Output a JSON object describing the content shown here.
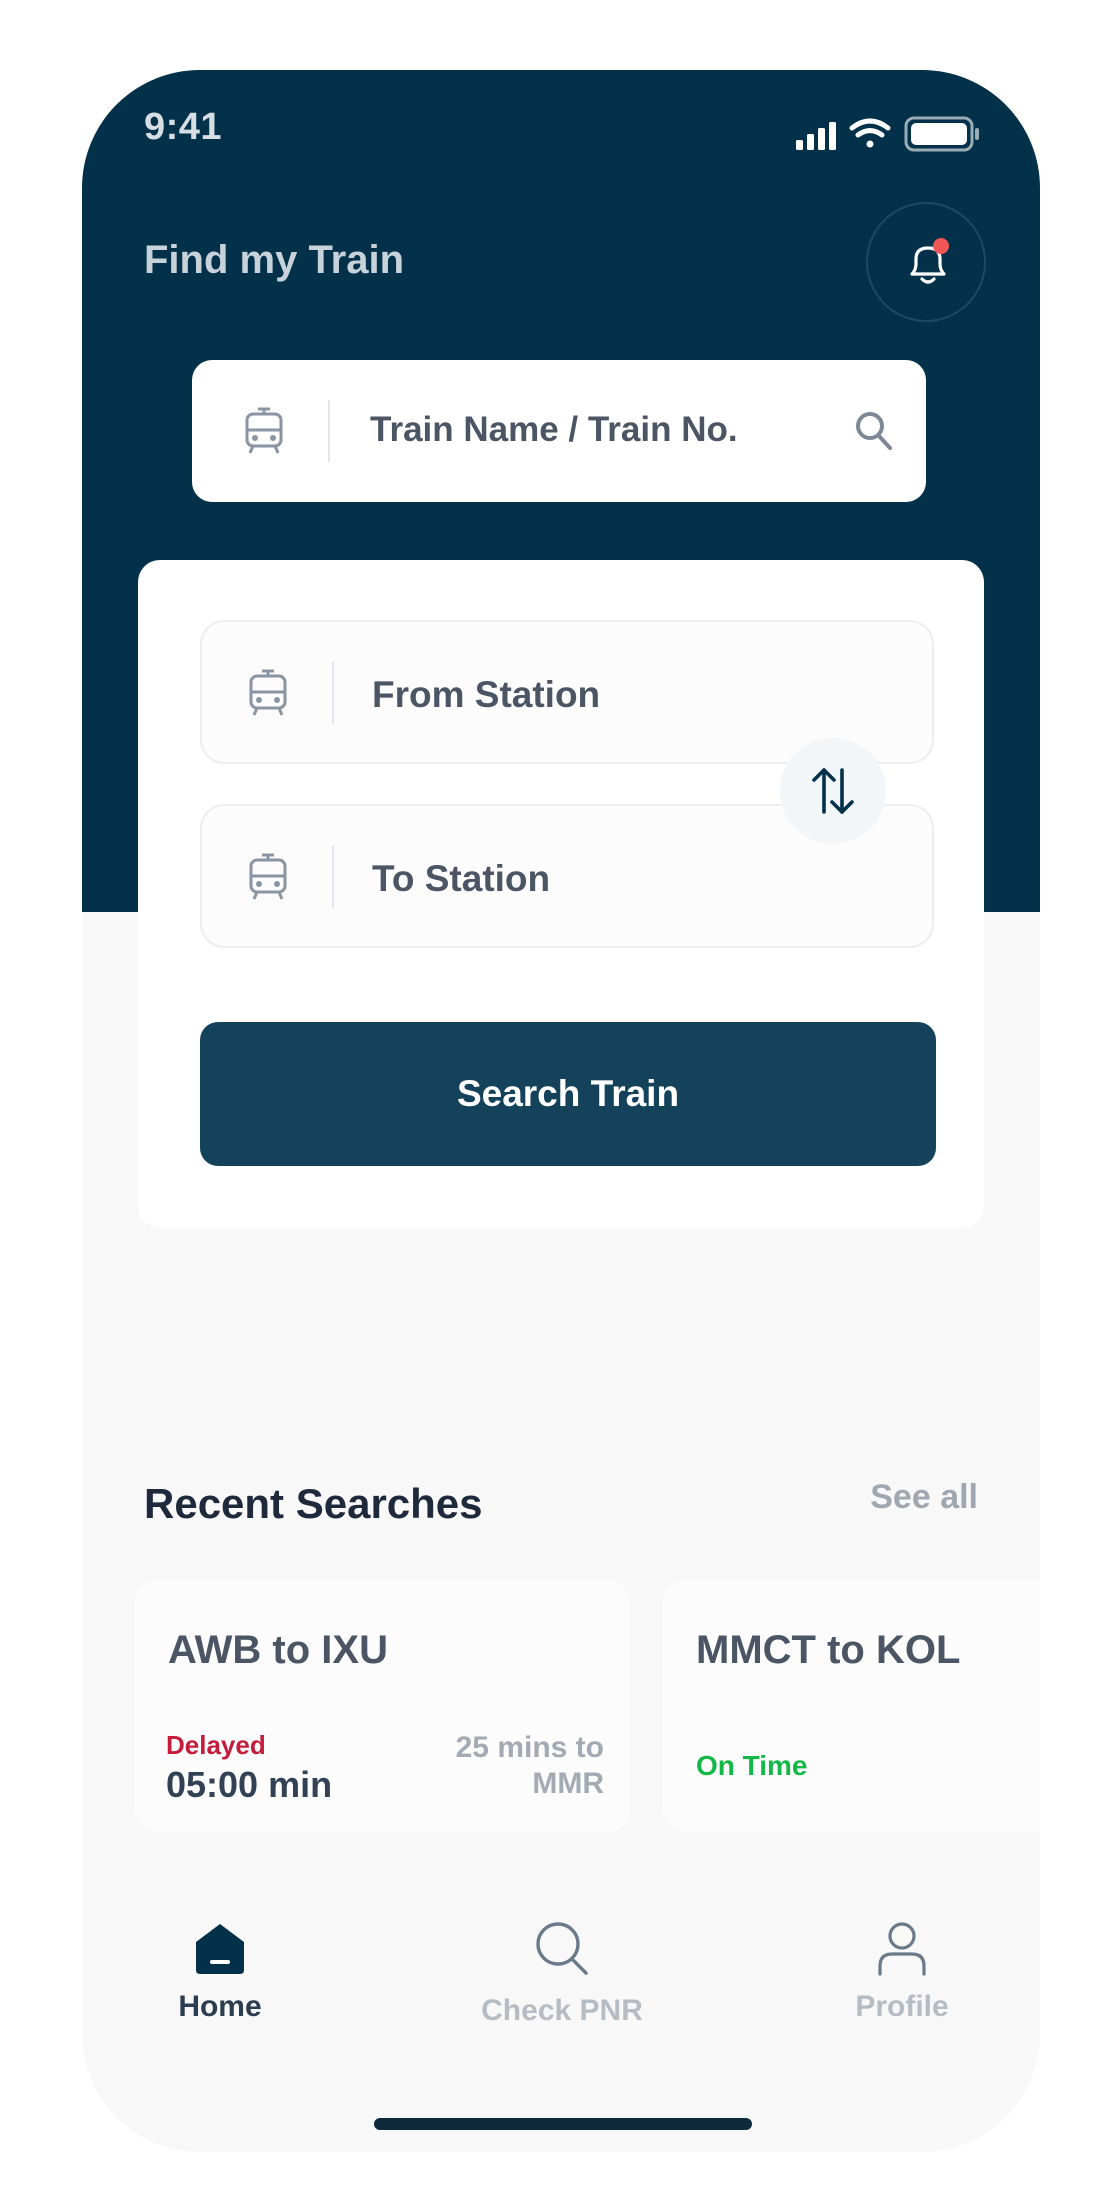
{
  "status_bar": {
    "time": "9:41"
  },
  "header": {
    "title": "Find my Train",
    "notification_icon": "bell-icon",
    "has_unread": true
  },
  "train_search": {
    "placeholder": "Train Name / Train No.",
    "lead_icon": "train-icon",
    "action_icon": "search-icon"
  },
  "stations": {
    "from_placeholder": "From Station",
    "to_placeholder": "To Station",
    "swap_icon": "swap-vertical-icon",
    "search_button": "Search Train"
  },
  "recent": {
    "title": "Recent Searches",
    "see_all": "See all",
    "items": [
      {
        "route": "AWB to IXU",
        "status": "Delayed",
        "delay": "05:00 min",
        "eta": "25 mins to MMR"
      },
      {
        "route": "MMCT to KOL",
        "status": "On Time"
      }
    ]
  },
  "nav": {
    "items": [
      {
        "label": "Home",
        "icon": "home-icon",
        "active": true
      },
      {
        "label": "Check PNR",
        "icon": "search-icon",
        "active": false
      },
      {
        "label": "Profile",
        "icon": "user-icon",
        "active": false
      }
    ]
  },
  "colors": {
    "primary": "#03314a",
    "button": "#15425b",
    "delayed": "#c51c3b",
    "on_time": "#14b847",
    "notification_dot": "#f25555"
  }
}
